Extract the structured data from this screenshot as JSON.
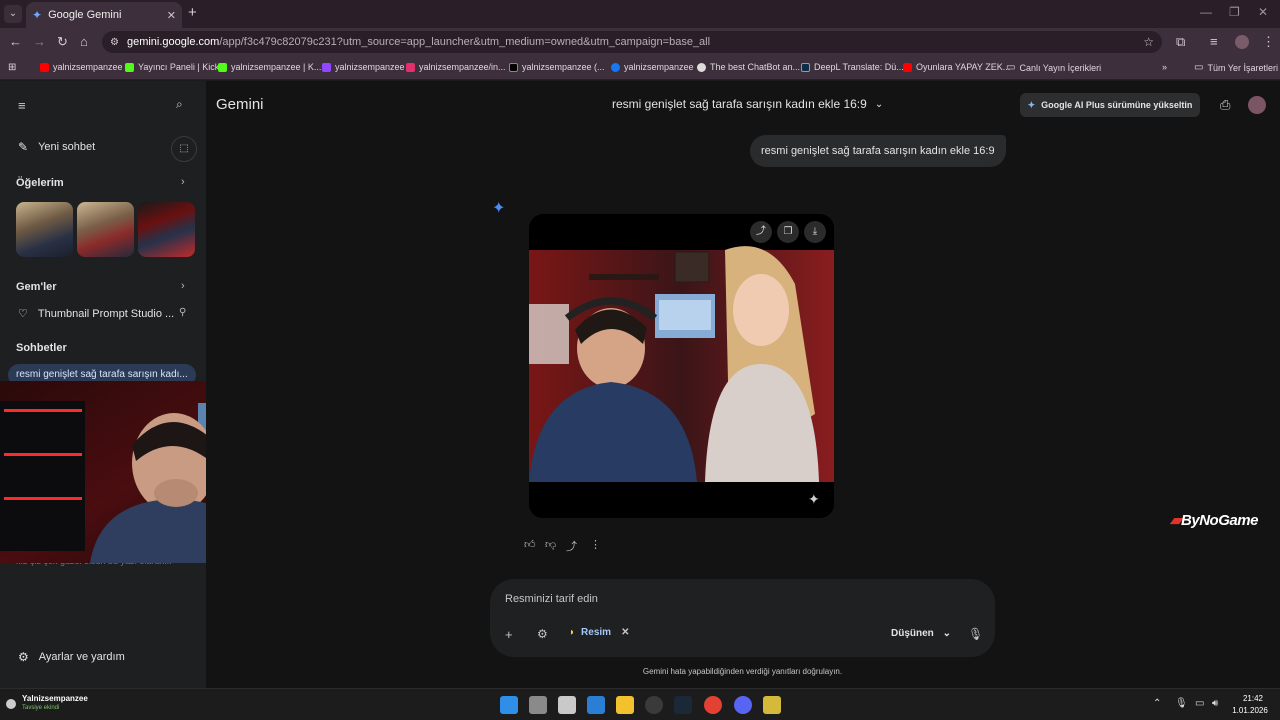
{
  "browser": {
    "tab_title": "Google Gemini",
    "url_host": "gemini.google.com",
    "url_path": "/app/f3c479c82079c231?utm_source=app_launcher&utm_medium=owned&utm_campaign=base_all",
    "bookmarks": [
      {
        "label": "yalnizsempanzee",
        "color": "#ff0000"
      },
      {
        "label": "Yayıncı Paneli | Kick",
        "color": "#53fc18"
      },
      {
        "label": "yalnizsempanzee | K...",
        "color": "#53fc18"
      },
      {
        "label": "yalnizsempanzee",
        "color": "#9146ff"
      },
      {
        "label": "yalnizsempanzee/in...",
        "color": "#e1306c"
      },
      {
        "label": "yalnizsempanzee (...",
        "color": "#111111"
      },
      {
        "label": "yalnizsempanzee",
        "color": "#1877f2"
      },
      {
        "label": "The best ChatBot an...",
        "color": "#dddddd"
      },
      {
        "label": "DeepL Translate: Dü...",
        "color": "#0f2b46"
      },
      {
        "label": "Oyunlara YAPAY ZEK...",
        "color": "#ff0000"
      },
      {
        "label": "Canlı Yayın İçerikleri",
        "color": "#cccccc"
      }
    ],
    "bookmarks_all": "Tüm Yer İşaretleri"
  },
  "sidebar": {
    "new_chat": "Yeni sohbet",
    "items_title": "Öğelerim",
    "gems_title": "Gem'ler",
    "gem_item": "Thumbnail Prompt Studio ...",
    "chats_title": "Sohbetler",
    "active_chat": "resmi genişlet sağ tarafa sarışın kadı...",
    "partial_chat": "kız çiz çok güzel olsun bu yazı olarak...",
    "settings": "Ayarlar ve yardım"
  },
  "header": {
    "app_name": "Gemini",
    "chat_title": "resmi genişlet sağ tarafa sarışın kadın ekle 16:9",
    "upgrade": "Google AI Plus sürümüne yükseltin"
  },
  "conversation": {
    "user_message": "resmi genişlet sağ tarafa sarışın kadın ekle 16:9"
  },
  "prompt": {
    "placeholder": "Resminizi tarif edin",
    "chip_label": "Resim",
    "mode": "Düşünen",
    "disclaimer": "Gemini hata yapabildiğinden verdiği yanıtları doğrulayın."
  },
  "overlay": {
    "brand": "ByNoGame"
  },
  "taskbar": {
    "user_name": "Yalnizsempanzee",
    "user_status": "Tavsiye ekindi",
    "time": "21:42",
    "date": "1.01.2026"
  }
}
